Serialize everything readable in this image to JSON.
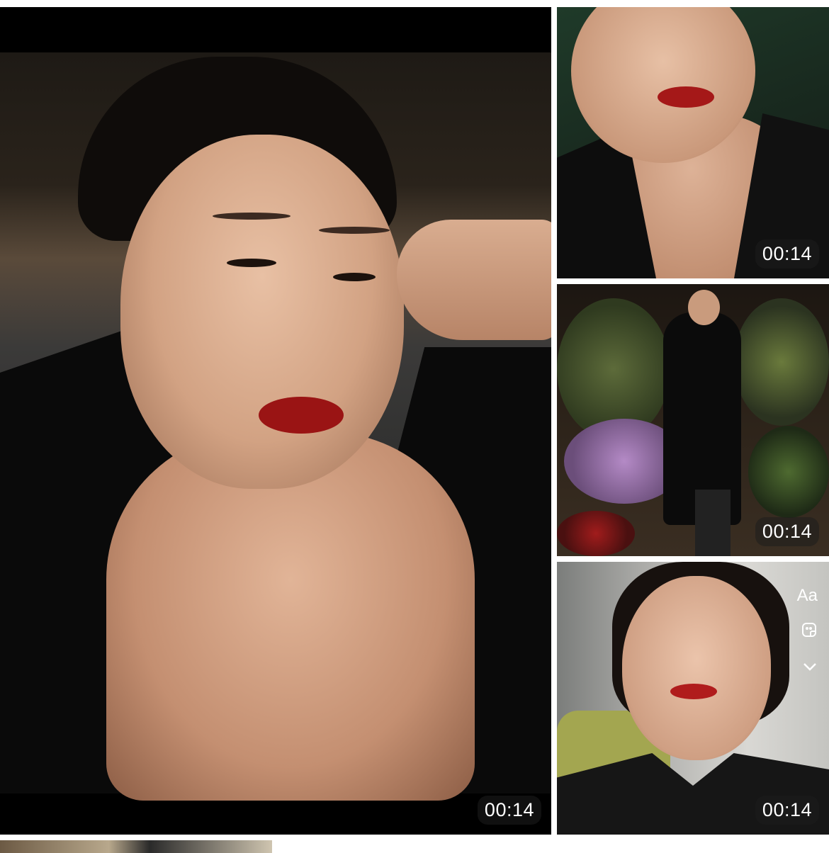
{
  "gallery": {
    "main_video": {
      "duration": "00:14"
    },
    "side_videos": [
      {
        "duration": "00:14"
      },
      {
        "duration": "00:14"
      },
      {
        "duration": "00:14"
      }
    ],
    "editor_tools": {
      "text_tool": "Aa",
      "sticker_icon": "sticker-icon",
      "chevron_icon": "chevron-down-icon"
    }
  },
  "colors": {
    "badge_bg": "#1e1e1e",
    "badge_text": "#ffffff",
    "background": "#ffffff"
  }
}
